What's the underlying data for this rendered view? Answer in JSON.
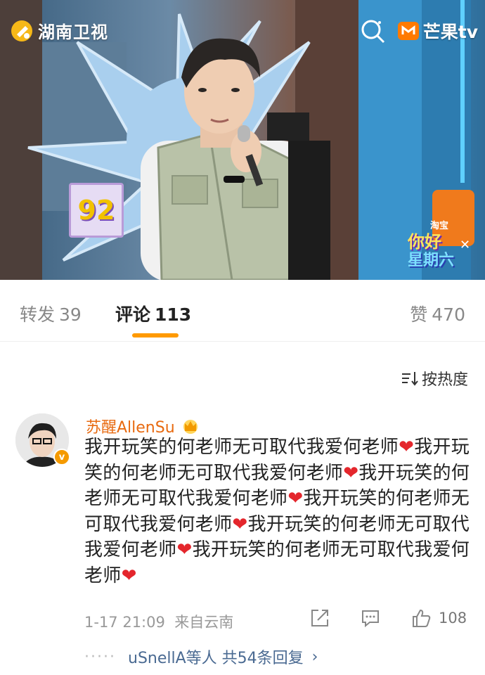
{
  "video": {
    "channel_name": "湖南卫视",
    "platform_name": "芒果tv",
    "score": "92",
    "show_brand": "淘宝",
    "show_title_line1": "你好",
    "show_title_line2": "星期六",
    "close_glyph": "✕",
    "colors": {
      "flower": "#a9cfee",
      "accent": "#ff9a00"
    }
  },
  "tabs": {
    "repost": {
      "label": "转发",
      "count": "39"
    },
    "comments": {
      "label": "评论",
      "count": "113"
    },
    "likes": {
      "label": "赞",
      "count": "470"
    }
  },
  "sort": {
    "label": "按热度",
    "icon": "sort-icon"
  },
  "comment": {
    "username": "苏醒AllenSu",
    "verified_glyph": "v",
    "segments": [
      "我开玩笑的何老师无可取代我爱何老师",
      "我开玩笑的何老师无可取代我爱何老师",
      "我开玩笑的何老师无可取代我爱何老师",
      "我开玩笑的何老师无可取代我爱何老师",
      "我开玩笑的何老师无可取代我爱何老师",
      "我开玩笑的何老师无可取代我爱何老师"
    ],
    "heart": "❤",
    "time": "1-17 21:09",
    "location": "来自云南",
    "like_count": "108",
    "replies_dots": "·····",
    "replies_text": "uSnellA等人 共54条回复",
    "replies_chevron": "›"
  }
}
